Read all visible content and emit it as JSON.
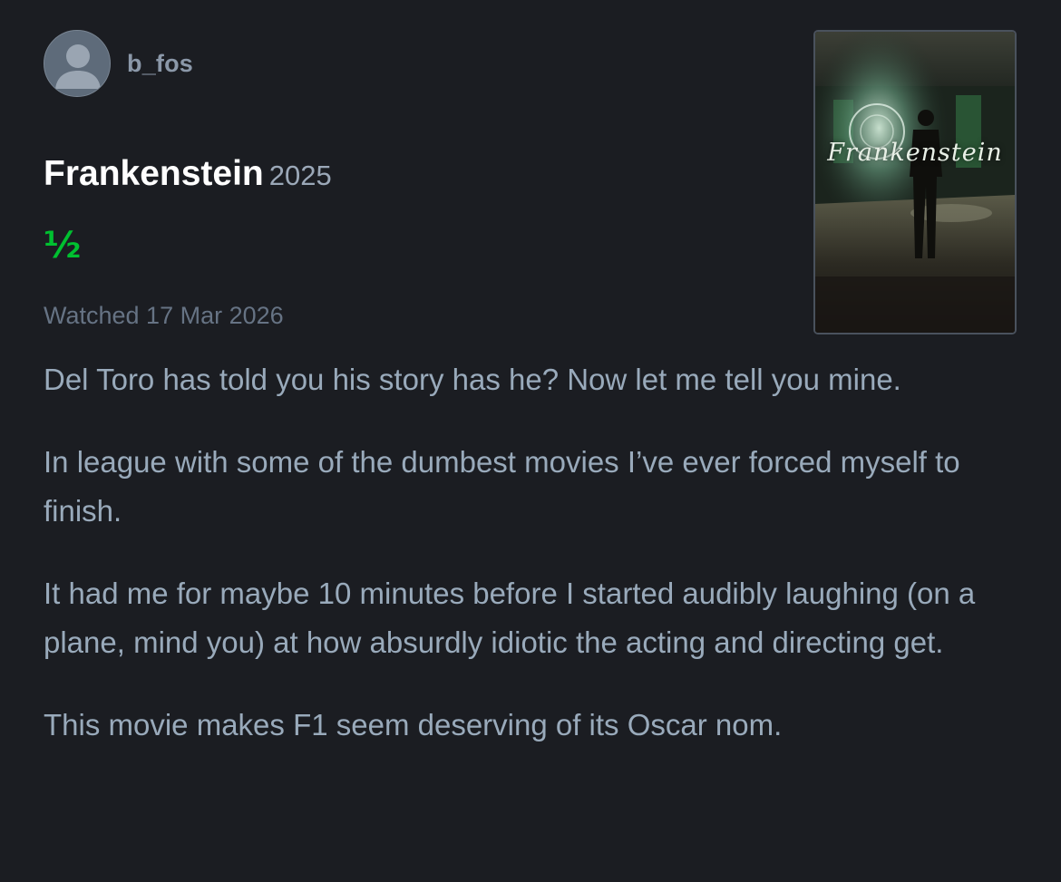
{
  "user": {
    "username": "b_fos",
    "avatar_icon": "default-user-avatar-icon"
  },
  "film": {
    "title": "Frankenstein",
    "year": "2025",
    "rating": "½",
    "rating_color": "#00c030",
    "poster_title": "Frankenstein"
  },
  "watched": "Watched 17 Mar 2026",
  "review": {
    "paragraphs": [
      "Del Toro has told you his story has he?  Now let me tell you mine.",
      "In league with some of the dumbest movies I’ve ever forced myself to finish.",
      "It had me for maybe 10 minutes before I started audibly laughing (on a plane, mind you) at how absurdly idiotic the acting and directing get.",
      "This movie makes F1 seem deserving of its Oscar nom."
    ]
  }
}
